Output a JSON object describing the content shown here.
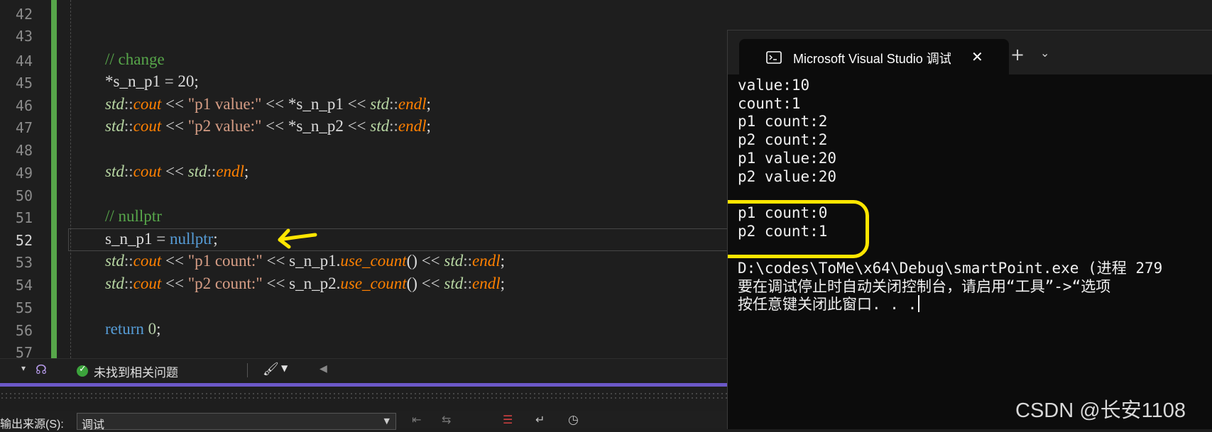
{
  "editor": {
    "line_numbers": [
      "42",
      "43",
      "44",
      "45",
      "46",
      "47",
      "48",
      "49",
      "50",
      "51",
      "52",
      "53",
      "54",
      "55",
      "56",
      "57"
    ],
    "active_line": "52",
    "code": {
      "l44_comment": "// change",
      "l45": "*s_n_p1 = 20;",
      "l46_a": "std",
      "l46_b": "::",
      "l46_c": "cout",
      "l46_d": " << ",
      "l46_e": "\"p1 value:\"",
      "l46_f": " << *s_n_p1 << ",
      "l46_g": "std",
      "l46_h": "::",
      "l46_i": "endl",
      "l46_j": ";",
      "l47_e": "\"p2 value:\"",
      "l47_f": " << *s_n_p2 << ",
      "l49_f": " << ",
      "l49_g": "std",
      "l51_comment": "// nullptr",
      "l52_var": "s_n_p1",
      "l52_eq": " = ",
      "l52_kw": "nullptr",
      "l52_semi": ";",
      "l53_e": "\"p1 count:\"",
      "l53_f": " << s_n_p1.",
      "l53_fn": "use_count",
      "l53_g": "() << ",
      "l54_e": "\"p2 count:\"",
      "l54_f": " << s_n_p2.",
      "l56_kw": "return",
      "l56_num": " 0",
      "l56_semi": ";"
    }
  },
  "status": {
    "issues_text": "未找到相关问题"
  },
  "output_panel": {
    "source_label": "输出来源(S):",
    "source_value": "调试"
  },
  "console": {
    "tab_title": "Microsoft Visual Studio 调试控制台",
    "lines": [
      "value:10",
      "count:1",
      "p1 count:2",
      "p2 count:2",
      "p1 value:20",
      "p2 value:20",
      "",
      "p1 count:0",
      "p2 count:1",
      "",
      "D:\\codes\\ToMe\\x64\\Debug\\smartPoint.exe (进程 279",
      "要在调试停止时自动关闭控制台，请启用“工具”->“选项",
      "按任意键关闭此窗口. . ."
    ],
    "highlight_color": "#ffe600"
  },
  "watermark": "CSDN @长安1108",
  "colors": {
    "editor_bg": "#1e1e1e",
    "console_bg": "#0c0c0c",
    "comment": "#57a64a",
    "namespace": "#4ec9b0",
    "function": "#ff8000",
    "string": "#d69d85",
    "keyword": "#569cd6",
    "arrow": "#ffe600"
  }
}
